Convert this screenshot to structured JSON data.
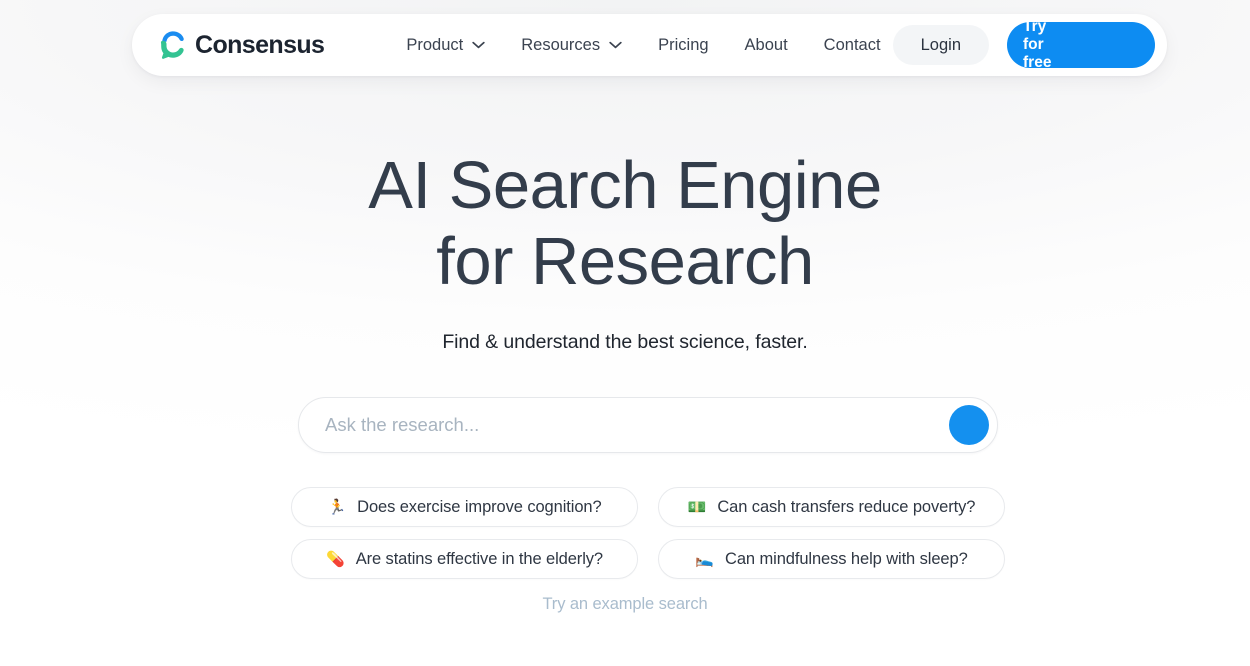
{
  "header": {
    "brand": {
      "name": "Consensus",
      "logo_icon": "consensus-c-logo",
      "logo_color_top": "#1a8cf0",
      "logo_color_bottom": "#33c392"
    },
    "nav": [
      {
        "label": "Product",
        "has_dropdown": true,
        "icon": "chevron-down-icon"
      },
      {
        "label": "Resources",
        "has_dropdown": true,
        "icon": "chevron-down-icon"
      },
      {
        "label": "Pricing",
        "has_dropdown": false,
        "icon": ""
      },
      {
        "label": "About",
        "has_dropdown": false,
        "icon": ""
      },
      {
        "label": "Contact",
        "has_dropdown": false,
        "icon": ""
      }
    ],
    "login_label": "Login",
    "try_label": "Try for free",
    "try_bg_color": "#0d8cf2"
  },
  "hero": {
    "title_line1": "AI Search Engine",
    "title_line2": "for Research",
    "subtitle": "Find & understand the best science, faster."
  },
  "search": {
    "value": "",
    "placeholder": "Ask the research...",
    "submit_icon": "search-submit-circle",
    "submit_color": "#1490ef"
  },
  "suggestions": [
    {
      "emoji": "🏃",
      "emoji_name": "runner-icon",
      "text": "Does exercise improve cognition?"
    },
    {
      "emoji": "💵",
      "emoji_name": "banknote-icon",
      "text": "Can cash transfers reduce poverty?"
    },
    {
      "emoji": "💊",
      "emoji_name": "pill-icon",
      "text": "Are statins effective in the elderly?"
    },
    {
      "emoji": "🛌",
      "emoji_name": "bed-sleep-icon",
      "text": "Can mindfulness help with sleep?"
    }
  ],
  "example_link_label": "Try an example search"
}
